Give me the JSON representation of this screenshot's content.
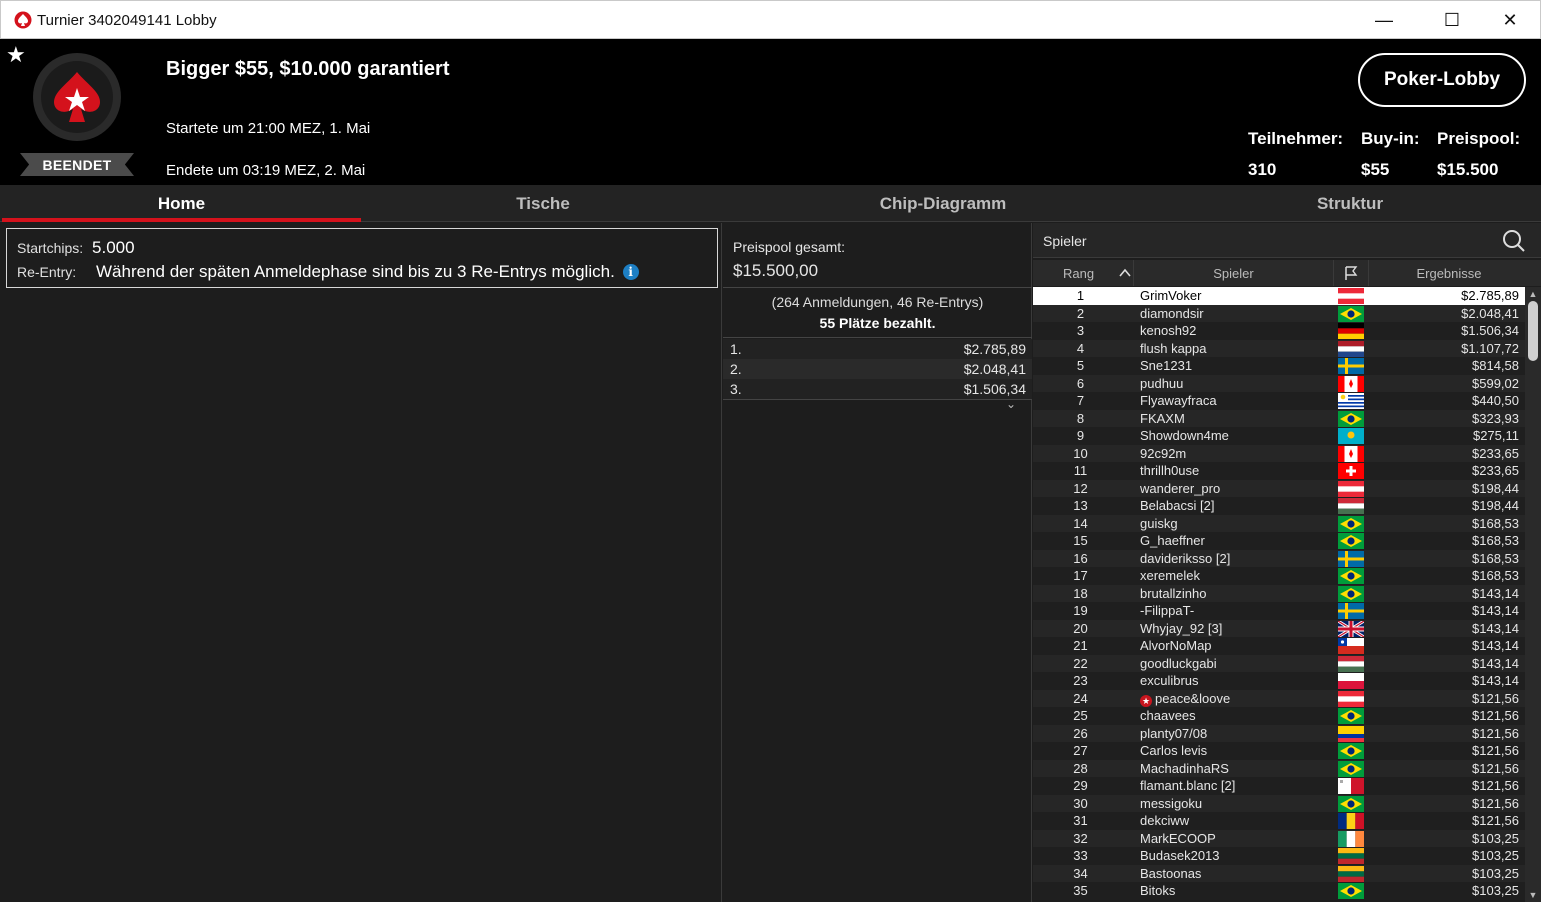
{
  "window": {
    "title": "Turnier 3402049141 Lobby",
    "minimize": "—",
    "maximize": "☐",
    "close": "✕"
  },
  "header": {
    "favorite_icon": "★",
    "logo": "pokerstars-spade-logo",
    "status": "BEENDET",
    "tournament_name": "Bigger $55, $10.000 garantiert",
    "start": "Startete um 21:00 MEZ, 1. Mai",
    "end": "Endete um 03:19 MEZ, 2. Mai",
    "lobby_button": "Poker-Lobby",
    "stats": [
      {
        "label": "Teilnehmer:",
        "value": "310"
      },
      {
        "label": "Buy-in:",
        "value": "$55"
      },
      {
        "label": "Preispool:",
        "value": "$15.500"
      }
    ],
    "accent": "#d4121c"
  },
  "tabs": [
    {
      "label": "Home",
      "active": true
    },
    {
      "label": "Tische",
      "active": false
    },
    {
      "label": "Chip-Diagramm",
      "active": false
    },
    {
      "label": "Struktur",
      "active": false
    }
  ],
  "info": {
    "startchips_label": "Startchips:",
    "startchips_value": "5.000",
    "reentry_label": "Re-Entry:",
    "reentry_value": "Während der späten Anmeldephase sind bis zu 3 Re-Entrys möglich.",
    "info_icon": "i"
  },
  "prizepool": {
    "label": "Preispool gesamt:",
    "value": "$15.500,00",
    "registrations": "(264 Anmeldungen, 46 Re-Entrys)",
    "paid": "55 Plätze bezahlt.",
    "payouts": [
      {
        "pos": "1.",
        "amount": "$2.785,89"
      },
      {
        "pos": "2.",
        "amount": "$2.048,41"
      },
      {
        "pos": "3.",
        "amount": "$1.506,34"
      }
    ],
    "expand_icon": "⌄"
  },
  "players": {
    "search_label": "Spieler",
    "columns": {
      "rank": "Rang",
      "player": "Spieler",
      "result": "Ergebnisse"
    },
    "rows": [
      {
        "rank": "1",
        "name": "GrimVoker",
        "flag": "austria",
        "result": "$2.785,89",
        "selected": true
      },
      {
        "rank": "2",
        "name": "diamondsir",
        "flag": "brazil",
        "result": "$2.048,41"
      },
      {
        "rank": "3",
        "name": "kenosh92",
        "flag": "germany",
        "result": "$1.506,34"
      },
      {
        "rank": "4",
        "name": "flush kappa",
        "flag": "netherlands",
        "result": "$1.107,72"
      },
      {
        "rank": "5",
        "name": "Sne1231",
        "flag": "sweden",
        "result": "$814,58"
      },
      {
        "rank": "6",
        "name": "pudhuu",
        "flag": "canada",
        "result": "$599,02"
      },
      {
        "rank": "7",
        "name": "Flyawayfraca",
        "flag": "uruguay",
        "result": "$440,50"
      },
      {
        "rank": "8",
        "name": "FKAXM",
        "flag": "brazil",
        "result": "$323,93"
      },
      {
        "rank": "9",
        "name": "Showdown4me",
        "flag": "kazakhstan",
        "result": "$275,11"
      },
      {
        "rank": "10",
        "name": "92c92m",
        "flag": "canada",
        "result": "$233,65"
      },
      {
        "rank": "11",
        "name": "thrillh0use",
        "flag": "switzerland",
        "result": "$233,65"
      },
      {
        "rank": "12",
        "name": "wanderer_pro",
        "flag": "austria",
        "result": "$198,44"
      },
      {
        "rank": "13",
        "name": "Belabacsi [2]",
        "flag": "hungary",
        "result": "$198,44"
      },
      {
        "rank": "14",
        "name": "guiskg",
        "flag": "brazil",
        "result": "$168,53"
      },
      {
        "rank": "15",
        "name": "G_haeffner",
        "flag": "brazil",
        "result": "$168,53"
      },
      {
        "rank": "16",
        "name": "davideriksso [2]",
        "flag": "sweden",
        "result": "$168,53"
      },
      {
        "rank": "17",
        "name": "xeremelek",
        "flag": "brazil",
        "result": "$168,53"
      },
      {
        "rank": "18",
        "name": "brutallzinho",
        "flag": "brazil",
        "result": "$143,14"
      },
      {
        "rank": "19",
        "name": "-FilippaT-",
        "flag": "sweden",
        "result": "$143,14"
      },
      {
        "rank": "20",
        "name": "Whyjay_92 [3]",
        "flag": "uk",
        "result": "$143,14"
      },
      {
        "rank": "21",
        "name": "AlvorNoMap",
        "flag": "chile",
        "result": "$143,14"
      },
      {
        "rank": "22",
        "name": "goodluckgabi",
        "flag": "hungary",
        "result": "$143,14"
      },
      {
        "rank": "23",
        "name": "exculibrus",
        "flag": "poland",
        "result": "$143,14"
      },
      {
        "rank": "24",
        "name": "peace&loove",
        "flag": "austria",
        "result": "$121,56",
        "badge": "★"
      },
      {
        "rank": "25",
        "name": "chaavees",
        "flag": "brazil",
        "result": "$121,56"
      },
      {
        "rank": "26",
        "name": "planty07/08",
        "flag": "ecuador",
        "result": "$121,56"
      },
      {
        "rank": "27",
        "name": "Carlos levis",
        "flag": "brazil",
        "result": "$121,56"
      },
      {
        "rank": "28",
        "name": "MachadinhaRS",
        "flag": "brazil",
        "result": "$121,56"
      },
      {
        "rank": "29",
        "name": "flamant.blanc [2]",
        "flag": "malta",
        "result": "$121,56"
      },
      {
        "rank": "30",
        "name": "messigoku",
        "flag": "brazil",
        "result": "$121,56"
      },
      {
        "rank": "31",
        "name": "dekciww",
        "flag": "romania",
        "result": "$121,56"
      },
      {
        "rank": "32",
        "name": "MarkECOOP",
        "flag": "ireland",
        "result": "$103,25"
      },
      {
        "rank": "33",
        "name": "Budasek2013",
        "flag": "lithuania",
        "result": "$103,25"
      },
      {
        "rank": "34",
        "name": "Bastoonas",
        "flag": "lithuania",
        "result": "$103,25"
      },
      {
        "rank": "35",
        "name": "Bitoks",
        "flag": "brazil",
        "result": "$103,25"
      }
    ]
  }
}
